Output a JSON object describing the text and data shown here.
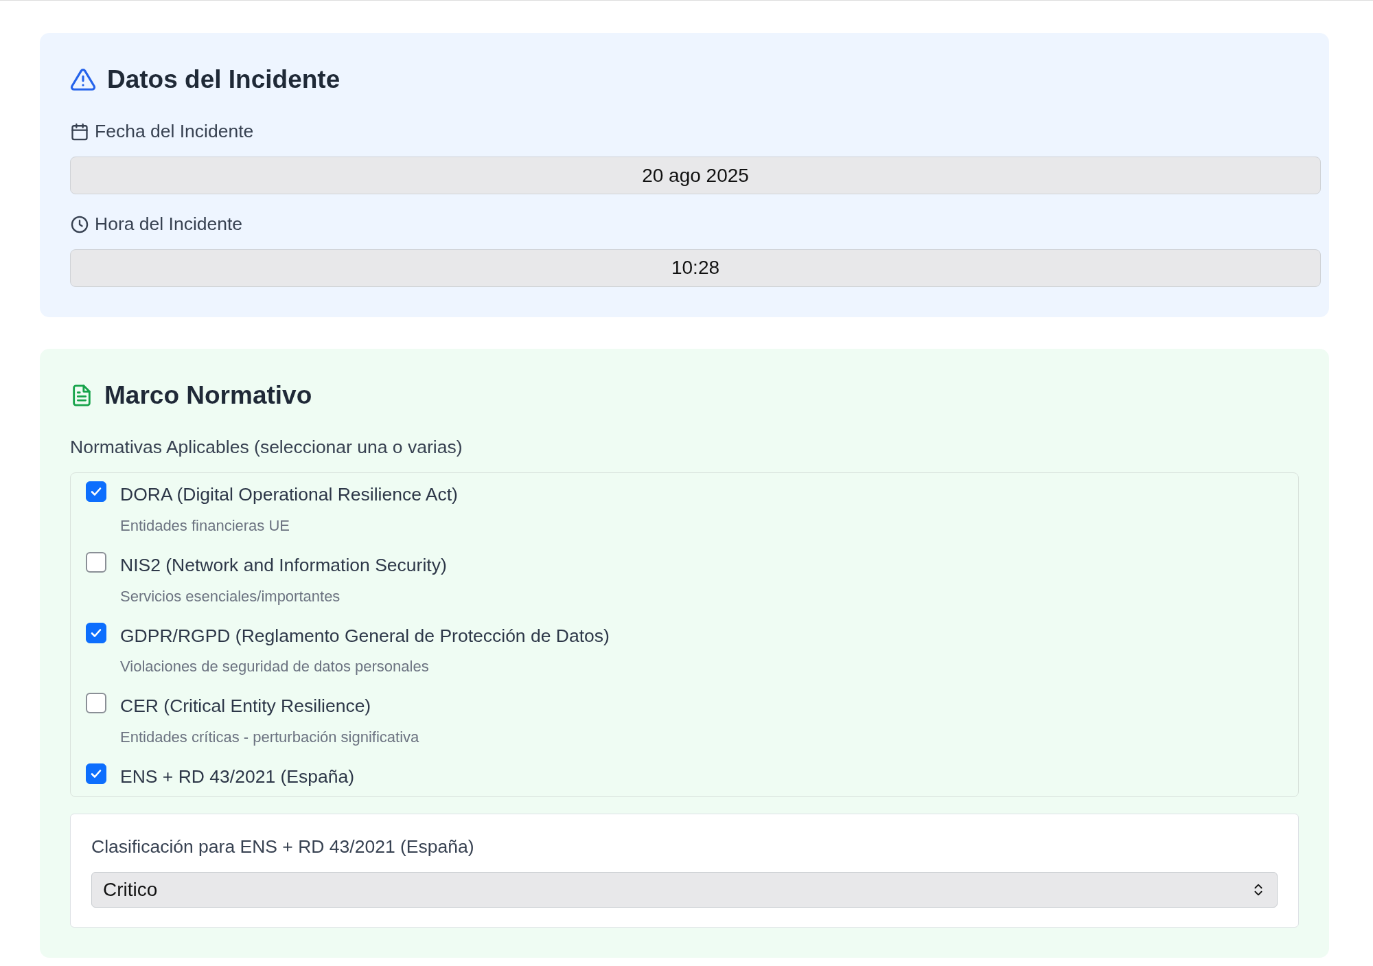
{
  "incident": {
    "title": "Datos del Incidente",
    "fields": [
      {
        "kind": "date",
        "label": "Fecha del Incidente",
        "value": "20 ago 2025"
      },
      {
        "kind": "time",
        "label": "Hora del Incidente",
        "value": "10:28"
      }
    ]
  },
  "framework": {
    "title": "Marco Normativo",
    "list_label": "Normativas Aplicables (seleccionar una o varias)",
    "regulations": [
      {
        "name": "DORA (Digital Operational Resilience Act)",
        "description": "Entidades financieras UE",
        "checked": true
      },
      {
        "name": "NIS2 (Network and Information Security)",
        "description": "Servicios esenciales/importantes",
        "checked": false
      },
      {
        "name": "GDPR/RGPD (Reglamento General de Protección de Datos)",
        "description": "Violaciones de seguridad de datos personales",
        "checked": true
      },
      {
        "name": "CER (Critical Entity Resilience)",
        "description": "Entidades críticas - perturbación significativa",
        "checked": false
      },
      {
        "name": "ENS + RD 43/2021 (España)",
        "checked": true
      }
    ],
    "classification": {
      "label": "Clasificación para ENS + RD 43/2021 (España)",
      "value": "Critico"
    }
  }
}
